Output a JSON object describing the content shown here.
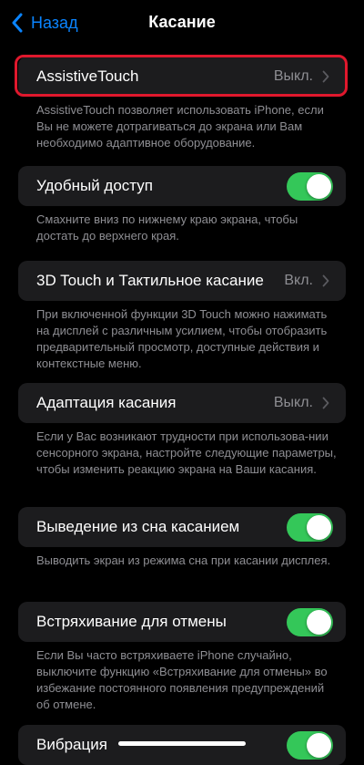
{
  "nav": {
    "back_label": "Назад",
    "title": "Касание"
  },
  "rows": [
    {
      "label": "AssistiveTouch",
      "value": "Выкл.",
      "footer": "AssistiveTouch позволяет использовать iPhone, если Вы не можете дотрагиваться до экрана или Вам необходимо адаптивное оборудование."
    },
    {
      "label": "Удобный доступ",
      "toggle": true,
      "footer": "Смахните вниз по нижнему краю экрана, чтобы достать до верхнего края."
    },
    {
      "label": "3D Touch и Тактильное касание",
      "value": "Вкл.",
      "footer": "При включенной функции 3D Touch можно нажимать на дисплей с различным усилием, чтобы отобразить предварительный просмотр, доступные действия и контекстные меню."
    },
    {
      "label": "Адаптация касания",
      "value": "Выкл.",
      "footer": "Если у Вас возникают трудности при использова-нии сенсорного экрана, настройте следующие параметры, чтобы изменить реакцию экрана на Ваши касания."
    },
    {
      "label": "Выведение из сна касанием",
      "toggle": true,
      "footer": "Выводить экран из режима сна при касании дисплея."
    },
    {
      "label": "Встряхивание для отмены",
      "toggle": true,
      "footer": "Если Вы часто встряхиваете iPhone случайно, выключите функцию «Встряхивание для отмены» во избежание постоянного появления предупреждений об отмене."
    },
    {
      "label": "Вибрация",
      "toggle": true
    }
  ],
  "colors": {
    "accent": "#0A84FF",
    "toggle_on": "#34C759",
    "highlight": "#E0182D",
    "cell_bg": "#1C1C1E",
    "secondary_text": "#8E8E93"
  },
  "icons": [
    "chevron-left-icon",
    "chevron-right-icon"
  ]
}
